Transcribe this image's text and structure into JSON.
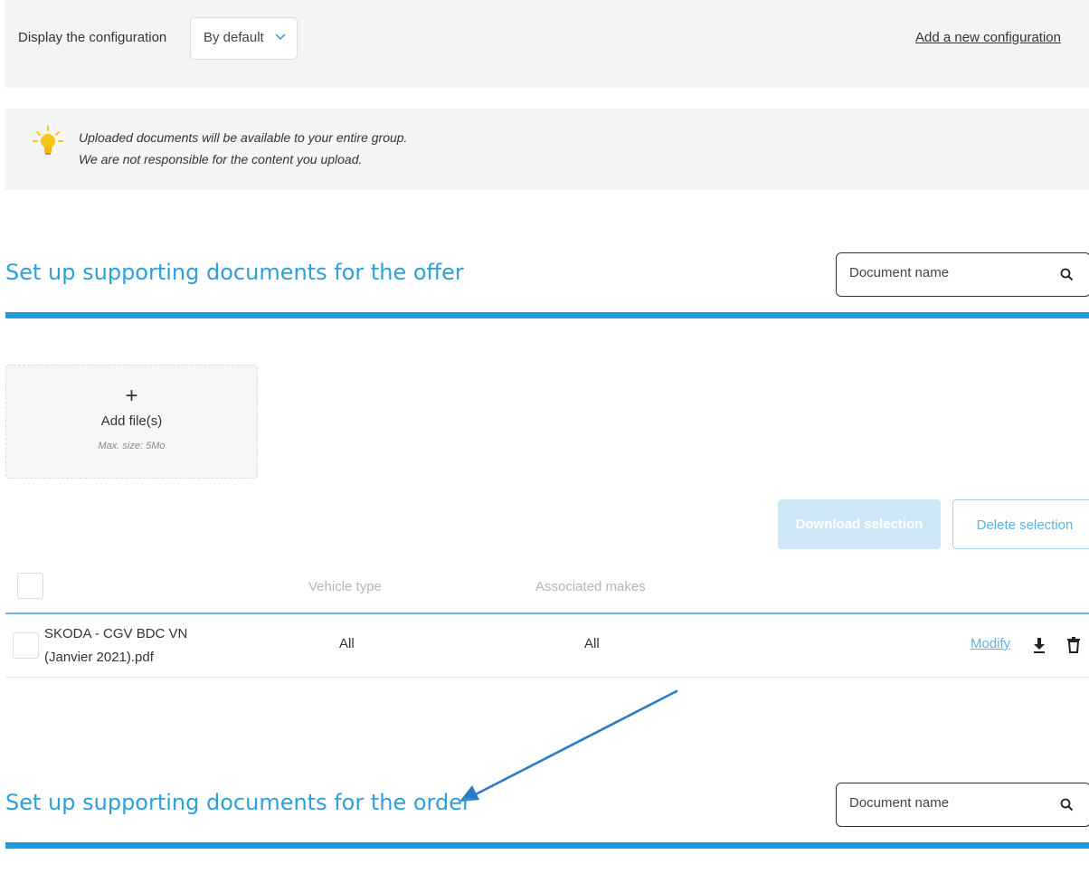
{
  "config_bar": {
    "label": "Display the configuration",
    "select_value": "By default",
    "add_link": "Add a new configuration"
  },
  "notice": {
    "icon": "lightbulb-icon",
    "line1": "Uploaded documents will be available to your entire group.",
    "line2": "We are not responsible for the content you upload."
  },
  "offer_section": {
    "title": "Set up supporting documents for the offer",
    "search_placeholder": "Document name",
    "upload": {
      "plus": "+",
      "label": "Add file(s)",
      "max_size": "Max. size: 5Mo"
    },
    "actions": {
      "download_selection": "Download selection",
      "delete_selection": "Delete selection"
    },
    "table": {
      "headers": [
        "",
        "Vehicle type",
        "Associated makes"
      ],
      "rows": [
        {
          "name_line1": "SKODA - CGV BDC VN",
          "name_line2": "(Janvier 2021).pdf",
          "vehicle_type": "All",
          "associated_makes": "All",
          "modify": "Modify"
        }
      ]
    }
  },
  "order_section": {
    "title": "Set up supporting documents for the order",
    "search_placeholder": "Document name"
  },
  "colors": {
    "accent": "#2f9fd8",
    "bar": "#1c9be0",
    "disabled_button": "#cde7f7",
    "annotation_arrow": "#2a7cc7"
  }
}
